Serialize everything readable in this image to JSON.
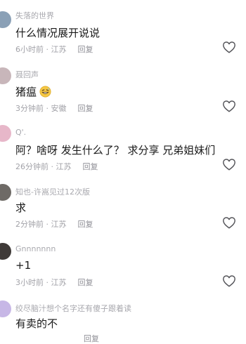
{
  "comments": [
    {
      "username": "失落的世界",
      "text": "什么情况展开说说",
      "time": "6小时前",
      "location": "江苏",
      "reply_label": "回复",
      "avatar_color": "#8aa0b6"
    },
    {
      "username": "聂回声",
      "text": "猪瘟",
      "emoji": "grinning-sweat-emoji",
      "time": "3分钟前",
      "location": "安徽",
      "reply_label": "回复",
      "avatar_color": "#c8b6ba"
    },
    {
      "username": "Q'.",
      "text": "阿？啥呀 发生什么了？ 求分享 兄弟姐妹们",
      "time": "26分钟前",
      "location": "江苏",
      "reply_label": "回复",
      "avatar_color": "#e7b7c9"
    },
    {
      "username": "知也-许嵩见过12次版",
      "text": "求",
      "time": "2分钟前",
      "location": "江苏",
      "reply_label": "回复",
      "avatar_color": "#6e6a66"
    },
    {
      "username": "Gnnnnnnn",
      "text": "+1",
      "time": "3小时前",
      "location": "江苏",
      "reply_label": "回复",
      "avatar_color": "#3f3a38"
    },
    {
      "username": "绞尽脑汁想个名字还有傻子跟着读",
      "text": "有卖的不",
      "time": "",
      "location": "",
      "reply_label": "回复",
      "avatar_color": "#c7b7e6"
    }
  ],
  "meta_separator": " · "
}
